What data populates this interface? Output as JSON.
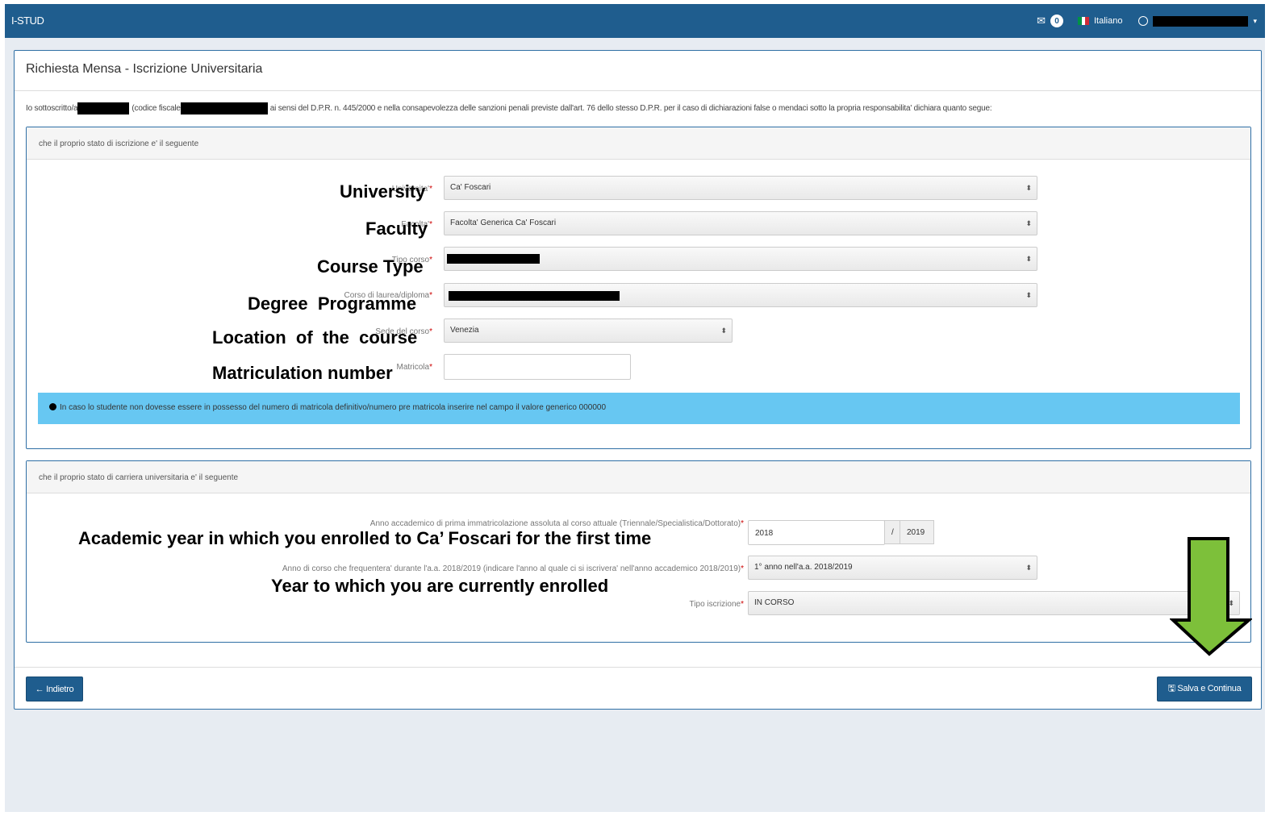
{
  "navbar": {
    "brand": "I-STUD",
    "mail_icon": "mail-icon",
    "notifications_count": "0",
    "language": "Italiano",
    "flag_colors": [
      "#009246",
      "#ffffff",
      "#ce2b37"
    ]
  },
  "page": {
    "title": "Richiesta Mensa - Iscrizione Universitaria",
    "declaration": {
      "part1": "Io sottoscritto/a",
      "part2": "(codice fiscale",
      "part3": "ai sensi del D.P.R. n. 445/2000 e nella consapevolezza delle sanzioni penali previste dall'art. 76 dello stesso D.P.R. per il caso di dichiarazioni false o mendaci sotto la propria responsabilita' dichiara quanto segue:"
    }
  },
  "enrollment": {
    "heading": "che il proprio stato di iscrizione e' il seguente",
    "fields": {
      "university": {
        "label": "Universita'",
        "value": "Ca' Foscari",
        "overlay": "University"
      },
      "faculty": {
        "label": "Facolta'",
        "value": "Facolta' Generica Ca' Foscari",
        "overlay": "Faculty"
      },
      "course_type": {
        "label": "Tipo corso",
        "overlay": "Course Type"
      },
      "degree": {
        "label": "Corso di laurea/diploma",
        "overlay": "Degree  Programme"
      },
      "location": {
        "label": "Sede del corso",
        "value": "Venezia",
        "overlay": "Location  of  the  course"
      },
      "matriculation": {
        "label": "Matricola",
        "value": "",
        "overlay": "Matriculation number"
      }
    },
    "info": "In caso lo studente non dovesse essere in possesso del numero di matricola definitivo/numero pre matricola inserire nel campo il valore generico 000000"
  },
  "career": {
    "heading": "che il proprio stato di carriera universitaria e' il seguente",
    "first_enrollment_label": "Anno accademico di prima immatricolazione assoluta al corso attuale (Triennale/Specialistica/Dottorato)",
    "first_enrollment_year": "2018",
    "first_enrollment_sep": "/",
    "first_enrollment_year_end": "2019",
    "first_enrollment_overlay": "Academic year in which you enrolled to Ca’ Foscari for the first time",
    "course_year_label": "Anno di corso che frequentera' durante l'a.a. 2018/2019 (indicare l'anno al quale ci si iscrivera' nell'anno accademico 2018/2019)",
    "course_year_value": "1° anno nell'a.a. 2018/2019",
    "course_year_overlay": "Year to which you are currently enrolled",
    "enrollment_type_label": "Tipo iscrizione",
    "enrollment_type_value": "IN CORSO"
  },
  "actions": {
    "back": "← Indietro",
    "save": "🖫 Salva e Continua"
  },
  "colors": {
    "navbar": "#1f5d8e",
    "info": "#67c7f2",
    "arrow": "#7dc03a"
  }
}
